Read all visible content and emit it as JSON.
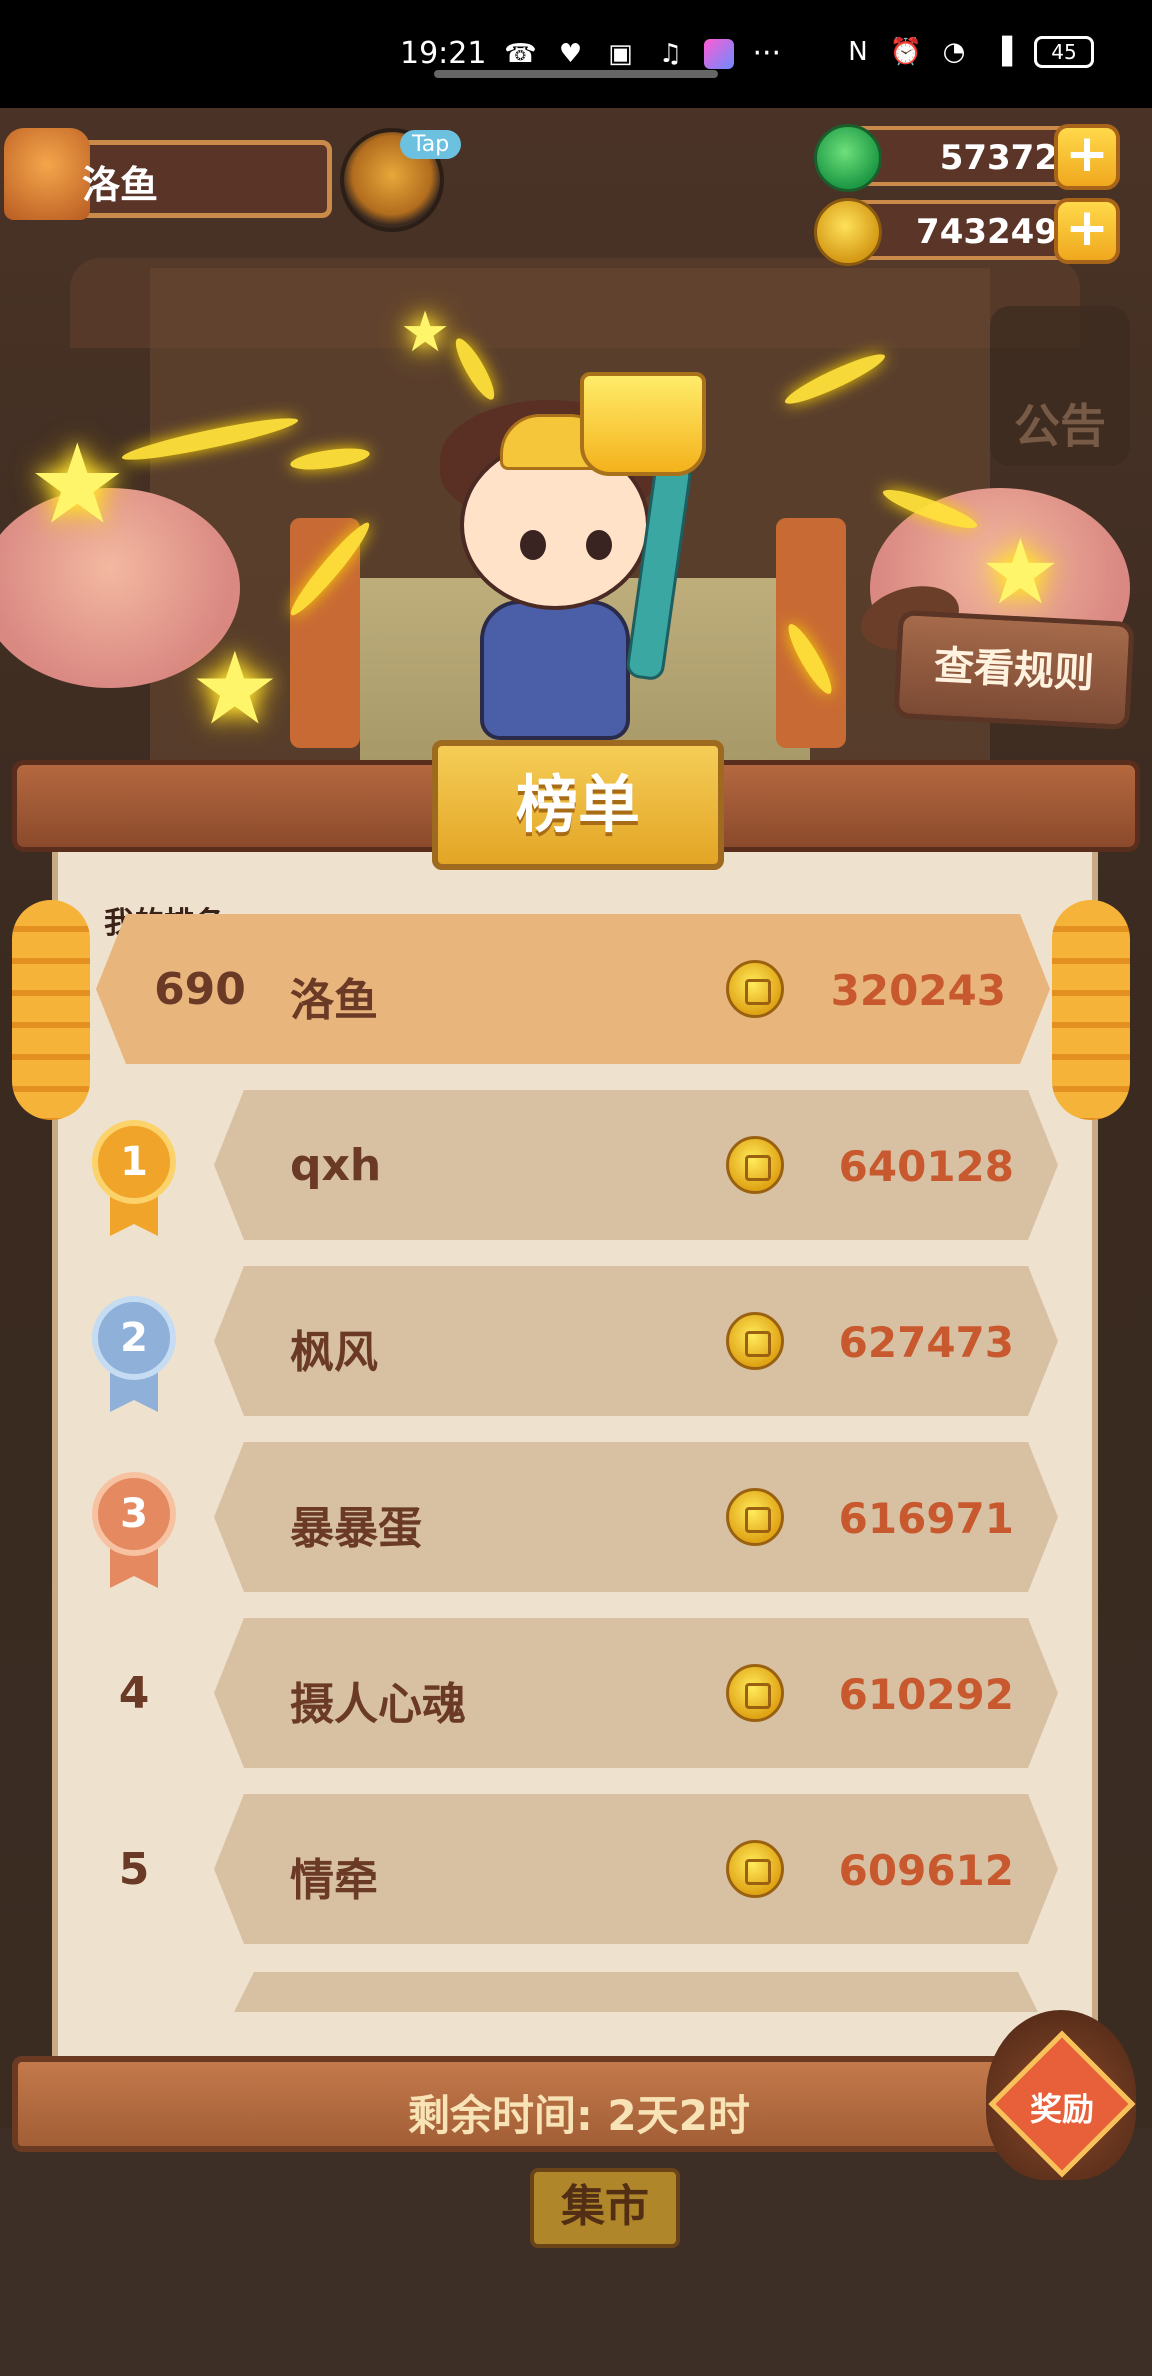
{
  "status_bar": {
    "time": "19:21",
    "battery": "45",
    "icons": [
      "missed-call-icon",
      "app-notification-icon",
      "tv-icon",
      "music-icon",
      "app-icon",
      "more-icon",
      "nfc-icon",
      "alarm-icon",
      "wifi-icon",
      "signal-5g-icon",
      "battery-icon"
    ],
    "more": "···"
  },
  "player": {
    "name": "洛鱼",
    "tap_label": "Tap"
  },
  "currencies": {
    "jade": {
      "value": "57372",
      "plus": "+"
    },
    "coin": {
      "value": "743249",
      "plus": "+"
    }
  },
  "notice": {
    "label": "公告"
  },
  "rules": {
    "label": "查看规则"
  },
  "board": {
    "title": "榜单",
    "my_rank_label": "我的排名",
    "mine": {
      "rank": "690",
      "name": "洛鱼",
      "score": "320243"
    },
    "rows": [
      {
        "rank": "1",
        "name": "qxh",
        "score": "640128",
        "medal": "gold"
      },
      {
        "rank": "2",
        "name": "枫风",
        "score": "627473",
        "medal": "silver"
      },
      {
        "rank": "3",
        "name": "暴暴蛋",
        "score": "616971",
        "medal": "bronze"
      },
      {
        "rank": "4",
        "name": "摄人心魂",
        "score": "610292",
        "medal": "none"
      },
      {
        "rank": "5",
        "name": "情牵",
        "score": "609612",
        "medal": "none"
      }
    ],
    "remaining_time": "剩余时间: 2天2时"
  },
  "reward": {
    "label": "奖励"
  },
  "market": {
    "label": "集市"
  },
  "colors": {
    "panel_paper": "#eee2cf",
    "row_bg": "#d8c1a3",
    "mine_row_bg": "#e8b57d",
    "score_text": "#c8582e",
    "title_gold": "#f5cd57"
  }
}
